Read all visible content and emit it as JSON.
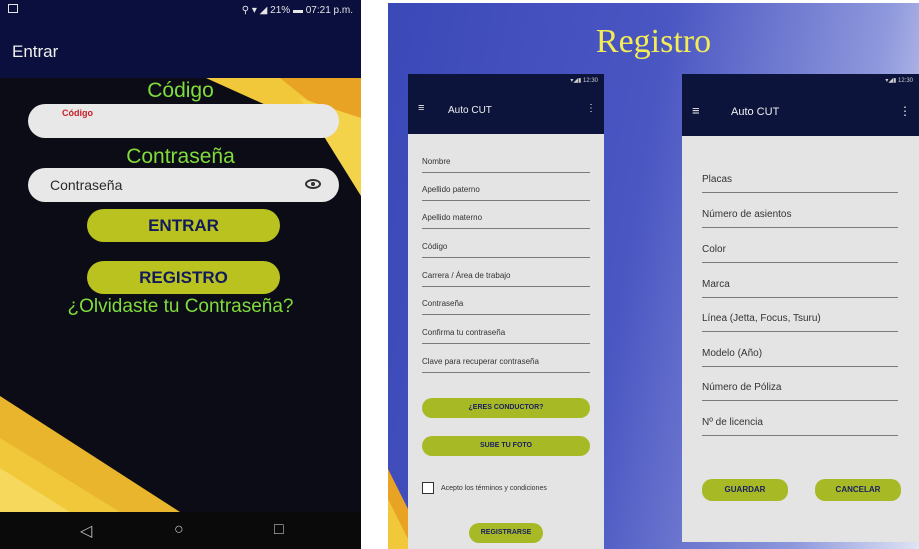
{
  "login_screen": {
    "status_bar": {
      "time": "07:21 p.m.",
      "battery": "21%"
    },
    "app_title": "Entrar",
    "codigo_label": "Código",
    "codigo_placeholder": "Código",
    "password_label": "Contraseña",
    "password_value": "Contraseña",
    "enter_button": "ENTRAR",
    "register_button": "REGISTRO",
    "forgot_link": "¿Olvidaste tu Contraseña?",
    "nav": {
      "back": "◁",
      "home": "○",
      "recents": "□"
    },
    "colors": {
      "label_green": "#7fdc3b",
      "button_olive": "#b9c21e",
      "button_text": "#111a5a",
      "appbar": "#0a0f3e"
    }
  },
  "registro": {
    "title": "Registro",
    "user_screen": {
      "status_time": "12:30",
      "app_title": "Auto CUT",
      "fields": [
        "Nombre",
        "Apellido paterno",
        "Apellido materno",
        "Código",
        "Carrera / Área de trabajo",
        "Contraseña",
        "Confirma tu contraseña",
        "Clave para recuperar contraseña"
      ],
      "driver_button": "¿ERES CONDUCTOR?",
      "photo_button": "SUBE TU FOTO",
      "terms_label": "Acepto los términos y condiciones",
      "register_button": "REGISTRARSE"
    },
    "vehicle_screen": {
      "status_time": "12:30",
      "app_title": "Auto CUT",
      "fields": [
        "Placas",
        "Número de asientos",
        "Color",
        "Marca",
        "Línea (Jetta, Focus, Tsuru)",
        "Modelo (Año)",
        "Número de Póliza",
        "Nº de licencia"
      ],
      "save_button": "GUARDAR",
      "cancel_button": "CANCELAR"
    },
    "colors": {
      "title": "#f4ec56",
      "panel_blue": "#3b49b8",
      "pill": "#a7ba26"
    }
  }
}
